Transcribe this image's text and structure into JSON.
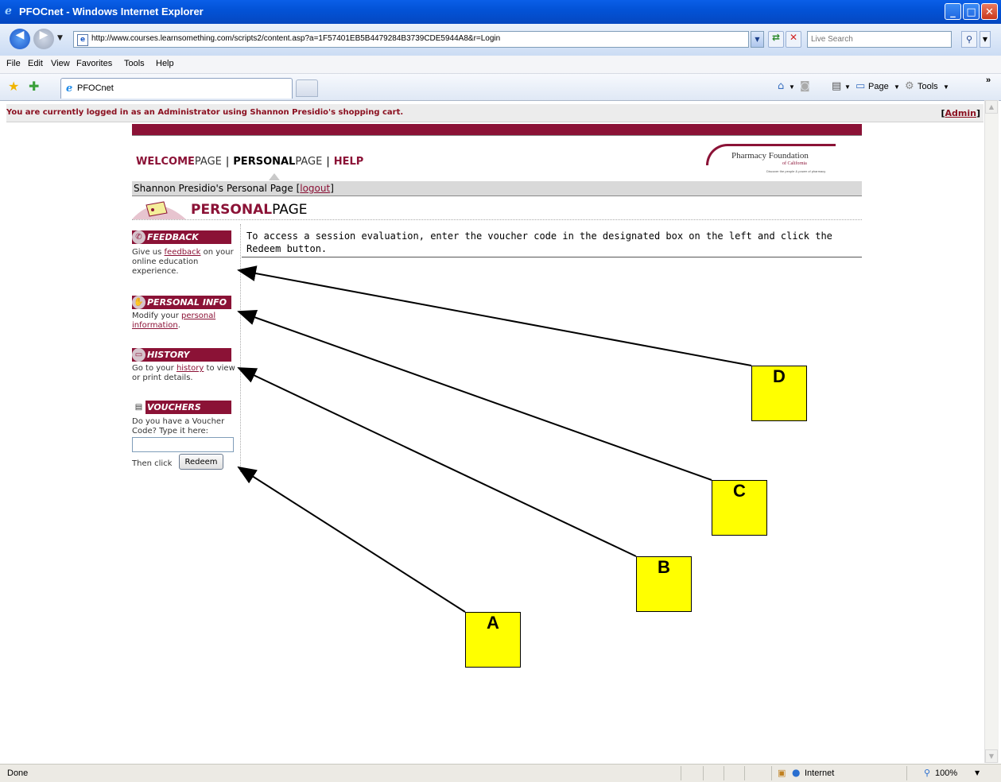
{
  "window": {
    "title": "PFOCnet - Windows Internet Explorer"
  },
  "address": {
    "url": "http://www.courses.learnsomething.com/scripts2/content.asp?a=1F57401EB5B4479284B3739CDE5944A8&r=Login",
    "search_placeholder": "Live Search"
  },
  "menu": [
    "File",
    "Edit",
    "View",
    "Favorites",
    "Tools",
    "Help"
  ],
  "tab": {
    "label": "PFOCnet"
  },
  "commands": {
    "page": "Page",
    "tools": "Tools"
  },
  "infobar": {
    "message": "You are currently logged in as an Administrator using Shannon Presidio's shopping cart.",
    "admin_link": "Admin"
  },
  "site": {
    "nav": {
      "welcome_bold": "WELCOME",
      "welcome_rest": "PAGE",
      "personal_bold": "PERSONAL",
      "personal_rest": "PAGE",
      "help": "HELP"
    },
    "logo": {
      "name": "Pharmacy Foundation",
      "sub": "of California",
      "tagline": "Discover the people & power of pharmacy"
    },
    "user_line": "Shannon Presidio's Personal Page",
    "logout": "logout",
    "heading_bold": "PERSONAL",
    "heading_rest": "PAGE"
  },
  "sidebar": {
    "feedback": {
      "title": "FEEDBACK",
      "pre": "Give us ",
      "link": "feedback",
      "post": " on your online education experience."
    },
    "personal_info": {
      "title": "PERSONAL INFO",
      "pre": "Modify your ",
      "link": "personal information",
      "post": "."
    },
    "history": {
      "title": "HISTORY",
      "pre": "Go to your ",
      "link": "history",
      "post": " to view or print details."
    },
    "vouchers": {
      "title": "VOUCHERS",
      "desc": "Do you have a Voucher Code? Type it here:",
      "then": "Then click",
      "button": "Redeem"
    }
  },
  "instruction": "To access a session evaluation, enter the voucher code in the designated box on the left and click the Redeem button.",
  "annotations": [
    "A",
    "B",
    "C",
    "D"
  ],
  "status": {
    "text": "Done",
    "zone": "Internet",
    "zoom": "100%"
  }
}
